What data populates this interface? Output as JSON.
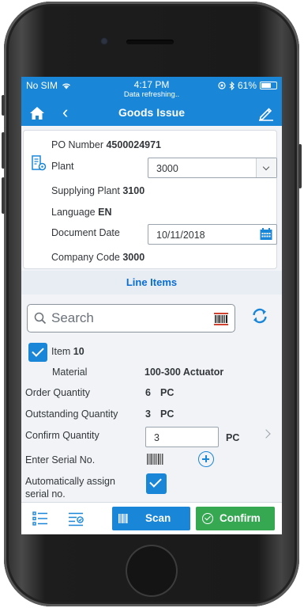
{
  "status": {
    "carrier": "No SIM",
    "time": "4:17 PM",
    "sub": "Data refreshing..",
    "battery": "61%"
  },
  "nav": {
    "title": "Goods Issue"
  },
  "header": {
    "po_label": "PO Number",
    "po_value": "4500024971",
    "plant_label": "Plant",
    "plant_value": "3000",
    "supplying_plant_label": "Supplying Plant",
    "supplying_plant_value": "3100",
    "language_label": "Language",
    "language_value": "EN",
    "doc_date_label": "Document Date",
    "doc_date_value": "10/11/2018",
    "company_code_label": "Company Code",
    "company_code_value": "3000"
  },
  "line_items": {
    "title": "Line Items",
    "search_placeholder": "Search",
    "item_label": "Item",
    "item_number": "10",
    "material_label": "Material",
    "material_value": "100-300 Actuator",
    "order_qty_label": "Order Quantity",
    "order_qty_value": "6",
    "order_qty_unit": "PC",
    "outstanding_label": "Outstanding Quantity",
    "outstanding_value": "3",
    "outstanding_unit": "PC",
    "confirm_qty_label": "Confirm Quantity",
    "confirm_qty_value": "3",
    "confirm_qty_unit": "PC",
    "serial_label": "Enter Serial No.",
    "auto_serial_label_1": "Automatically assign",
    "auto_serial_label_2": "serial no."
  },
  "footer": {
    "scan_label": "Scan",
    "confirm_label": "Confirm"
  },
  "colors": {
    "brand": "#1a86d8",
    "confirm": "#36a852"
  }
}
